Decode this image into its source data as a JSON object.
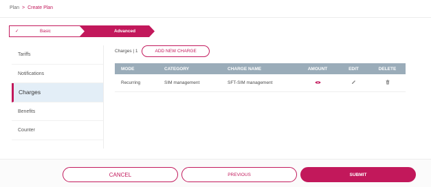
{
  "breadcrumb": {
    "parent": "Plan",
    "separator": ">",
    "current": "Create Plan"
  },
  "stepper": {
    "steps": [
      {
        "label": "Basic",
        "status": "completed",
        "check": "✓"
      },
      {
        "label": "Advanced",
        "status": "active"
      }
    ]
  },
  "sidebar": {
    "items": [
      {
        "label": "Tariffs"
      },
      {
        "label": "Notifications"
      },
      {
        "label": "Charges",
        "active": true
      },
      {
        "label": "Benefits"
      },
      {
        "label": "Counter"
      }
    ]
  },
  "charges": {
    "count_label": "Charges | 1",
    "add_button": "ADD NEW CHARGE",
    "columns": [
      "MODE",
      "CATEGORY",
      "CHARGE NAME",
      "AMOUNT",
      "EDIT",
      "DELETE"
    ],
    "rows": [
      {
        "mode": "Recurring",
        "category": "SIM management",
        "charge_name": "SFT-SIM management",
        "amount_icon": "eye-icon",
        "edit_icon": "pencil-icon",
        "delete_icon": "trash-icon"
      }
    ]
  },
  "footer": {
    "cancel": "CANCEL",
    "previous": "PREVIOUS",
    "submit": "SUBMIT"
  },
  "colors": {
    "accent": "#c2185b",
    "table_header": "#9aacb9",
    "active_side": "#e3eef7"
  }
}
